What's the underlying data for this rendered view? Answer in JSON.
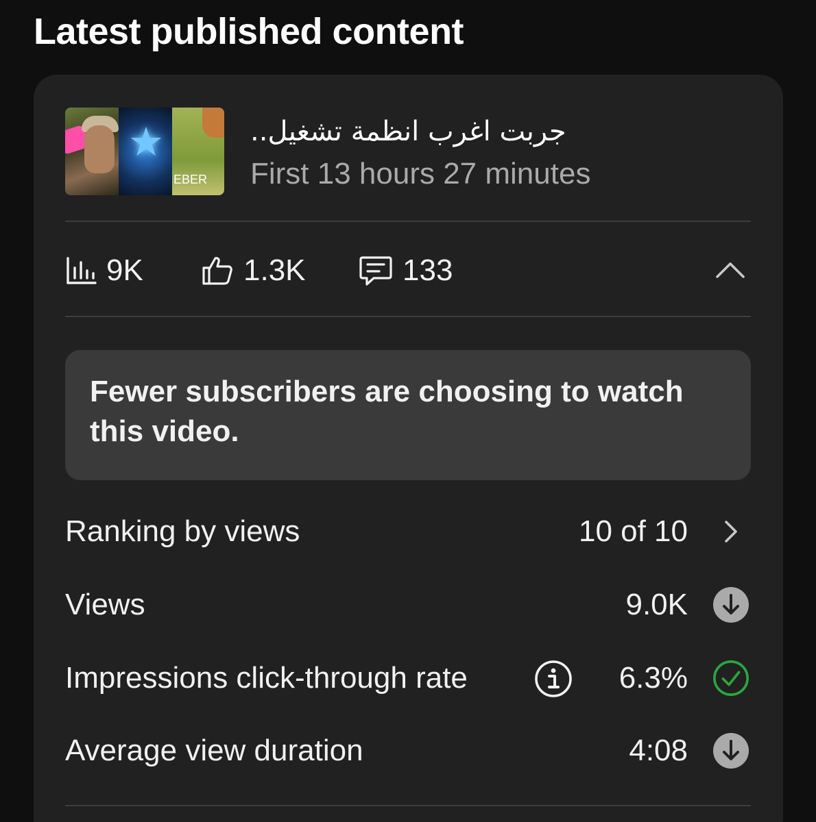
{
  "section": {
    "title": "Latest published content"
  },
  "video": {
    "title": "جربت اغرب انظمة تشغيل..",
    "subtitle": "First 13 hours 27 minutes",
    "thumbnail_text": "EBER"
  },
  "stats": {
    "views": "9K",
    "likes": "1.3K",
    "comments": "133"
  },
  "icons": {
    "views": "bar-chart-icon",
    "likes": "thumbs-up-icon",
    "comments": "comment-icon",
    "collapse": "chevron-up-icon"
  },
  "insight": {
    "text": "Fewer subscribers are choosing to watch this video."
  },
  "metrics": [
    {
      "label": "Ranking by views",
      "value": "10 of 10",
      "icon": "chevron-right-icon"
    },
    {
      "label": "Views",
      "value": "9.0K",
      "icon": "arrow-down-circle-icon",
      "status": "below typical"
    },
    {
      "label": "Impressions click-through rate",
      "value": "6.3%",
      "icon": "check-circle-icon",
      "status": "typical"
    },
    {
      "label": "Average view duration",
      "value": "4:08",
      "icon": "arrow-down-circle-icon",
      "status": "below typical"
    }
  ],
  "colors": {
    "background": "#0f0f0f",
    "card": "#212121",
    "insight_box": "#3a3a3a",
    "good": "#2ba640",
    "neutral_badge": "#aaaaaa"
  }
}
